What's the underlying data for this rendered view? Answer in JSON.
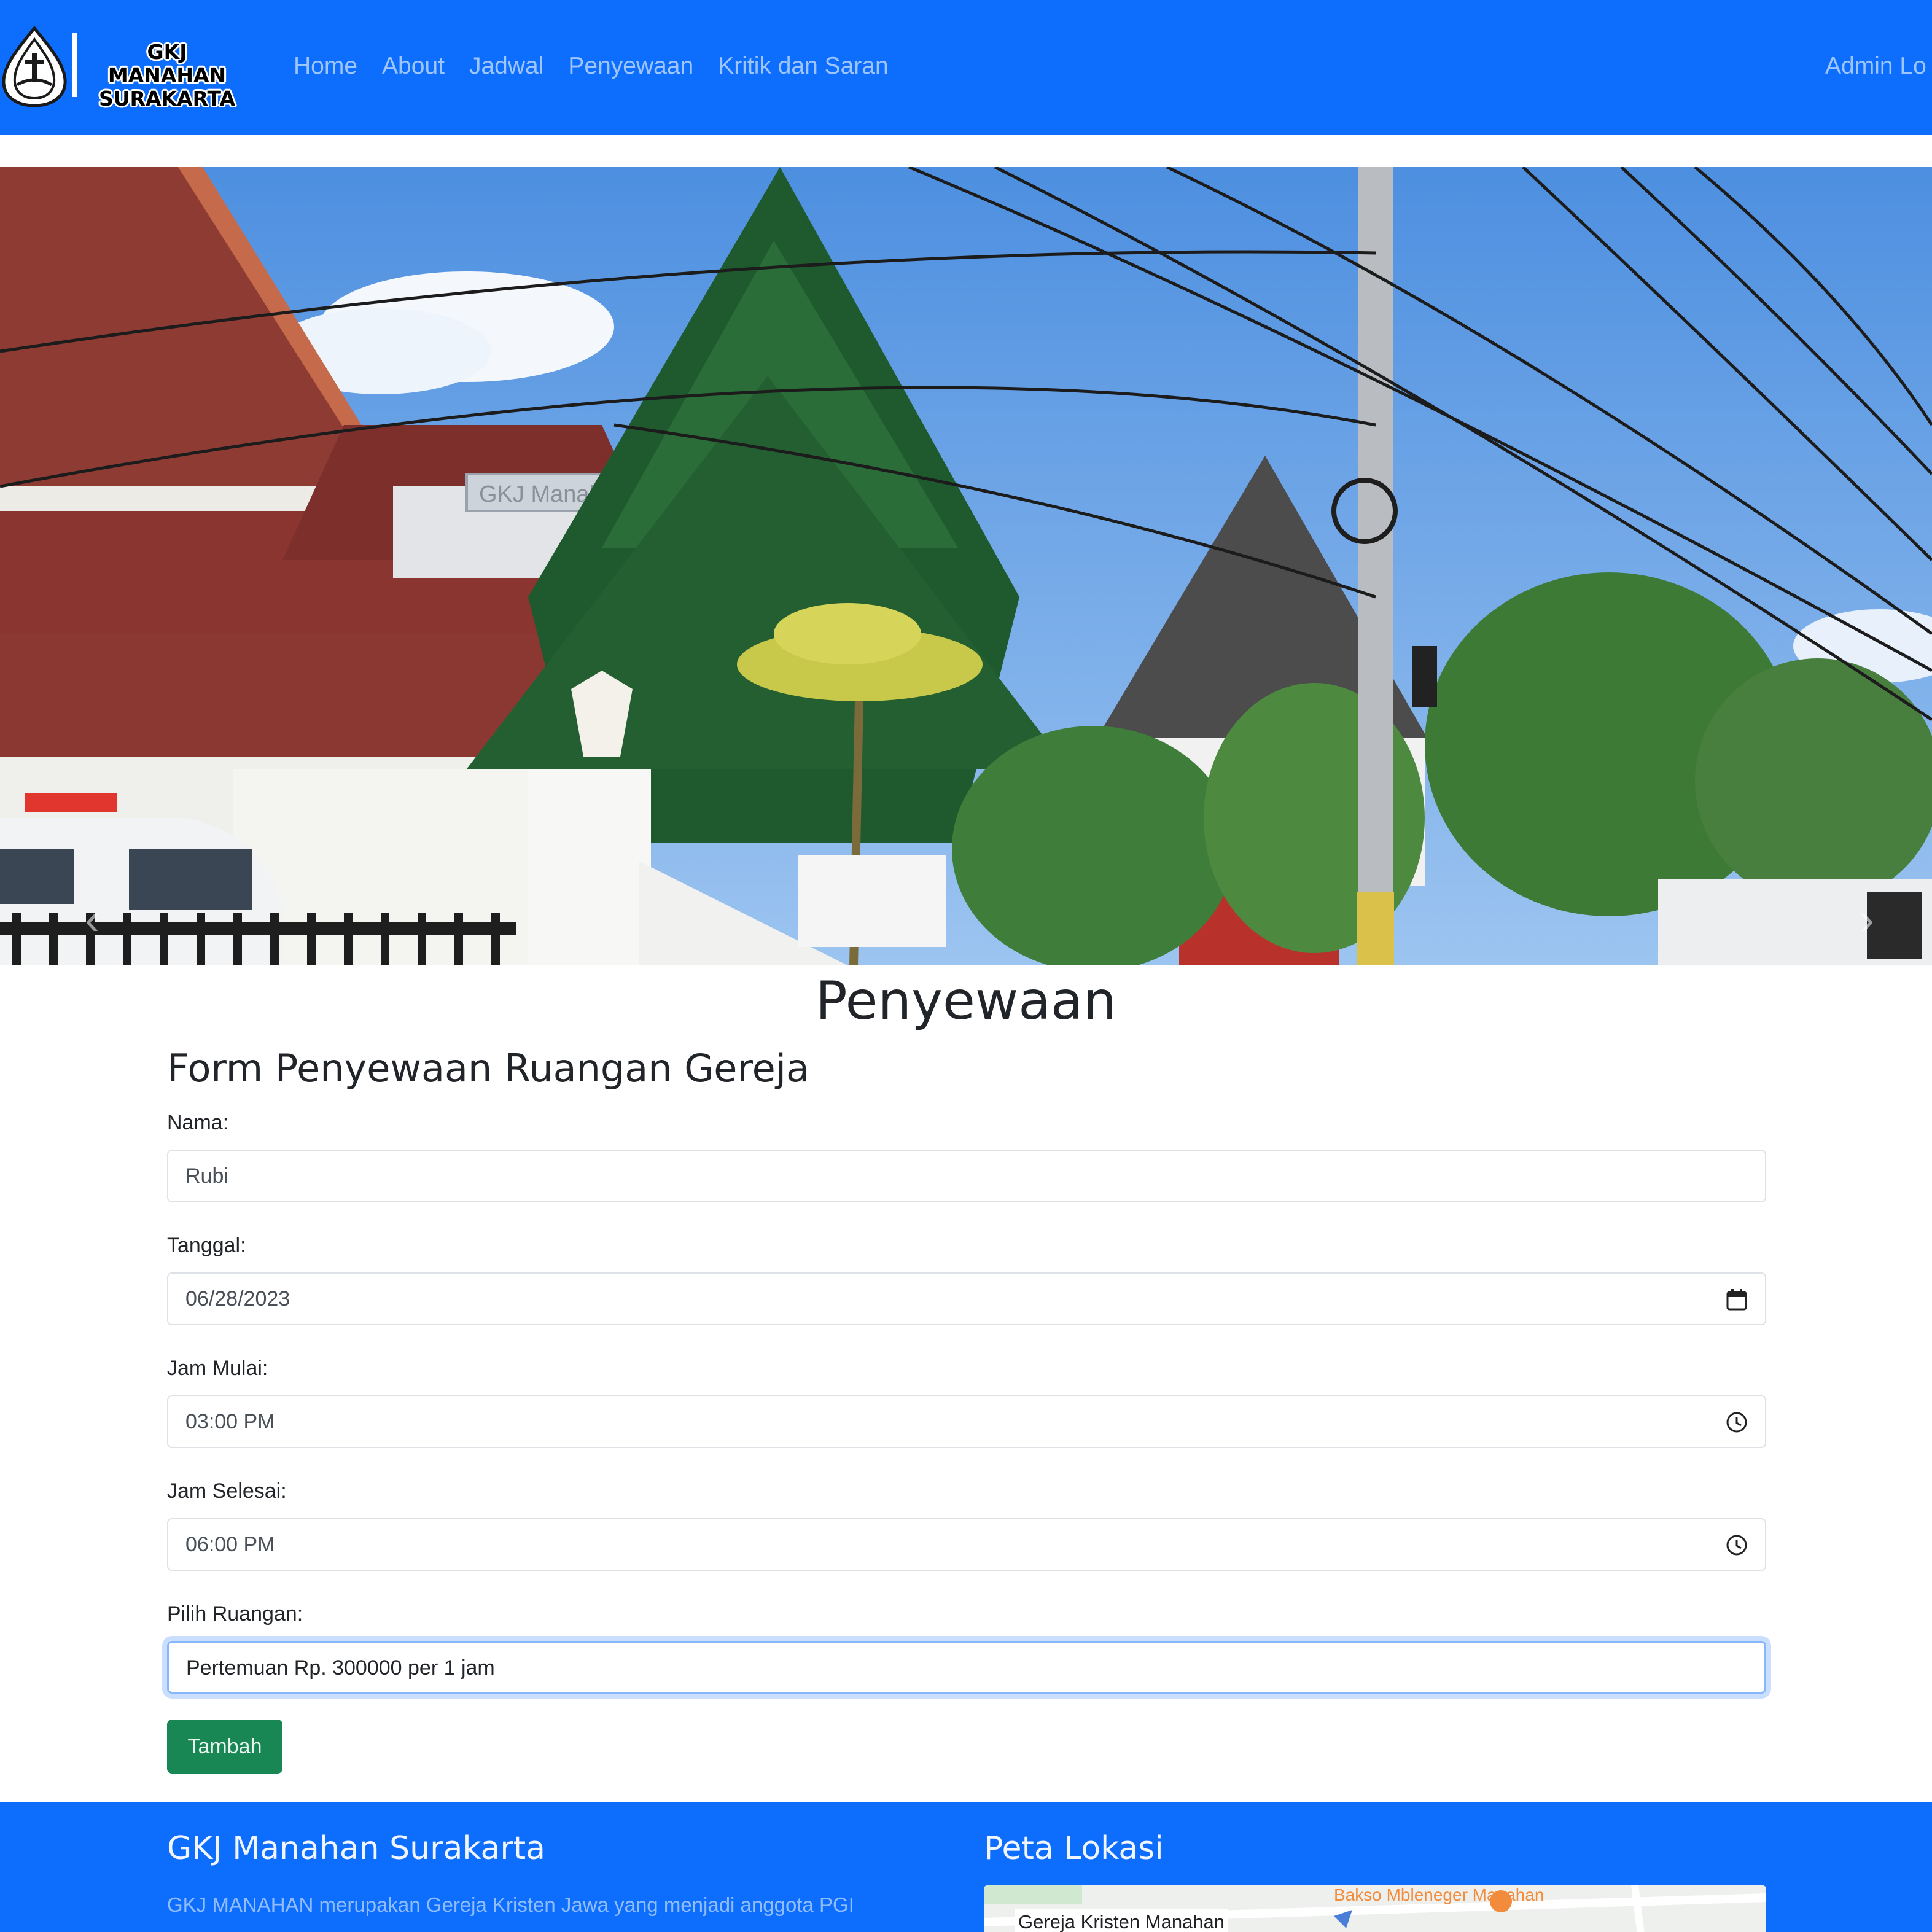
{
  "brand": {
    "logo_text_line1": "GKJ MANAHAN",
    "logo_text_line2": "SURAKARTA"
  },
  "navbar": {
    "items": [
      {
        "label": "Home"
      },
      {
        "label": "About"
      },
      {
        "label": "Jadwal"
      },
      {
        "label": "Penyewaan"
      },
      {
        "label": "Kritik dan Saran"
      }
    ],
    "admin_label": "Admin Lo"
  },
  "hero": {
    "sign_text": "GKJ Manahan"
  },
  "page": {
    "title": "Penyewaan",
    "form_title": "Form Penyewaan Ruangan Gereja"
  },
  "form": {
    "nama_label": "Nama:",
    "nama_value": "Rubi",
    "tanggal_label": "Tanggal:",
    "tanggal_value": "06/28/2023",
    "jam_mulai_label": "Jam Mulai:",
    "jam_mulai_value": "03:00 PM",
    "jam_selesai_label": "Jam Selesai:",
    "jam_selesai_value": "06:00 PM",
    "ruangan_label": "Pilih Ruangan:",
    "ruangan_value": "Pertemuan Rp. 300000 per 1 jam",
    "submit_label": "Tambah"
  },
  "footer": {
    "about_title": "GKJ Manahan Surakarta",
    "about_text": "GKJ MANAHAN merupakan Gereja Kristen Jawa yang menjadi anggota PGI",
    "map_title": "Peta Lokasi",
    "map_label": "Gereja Kristen Manahan",
    "map_poi": "Bakso Mbleneger Manahan"
  },
  "colors": {
    "primary": "#0d6efd",
    "success": "#198754",
    "focus_ring": "#86b7fe"
  },
  "icons": {
    "date": "calendar-icon",
    "time": "clock-icon"
  }
}
